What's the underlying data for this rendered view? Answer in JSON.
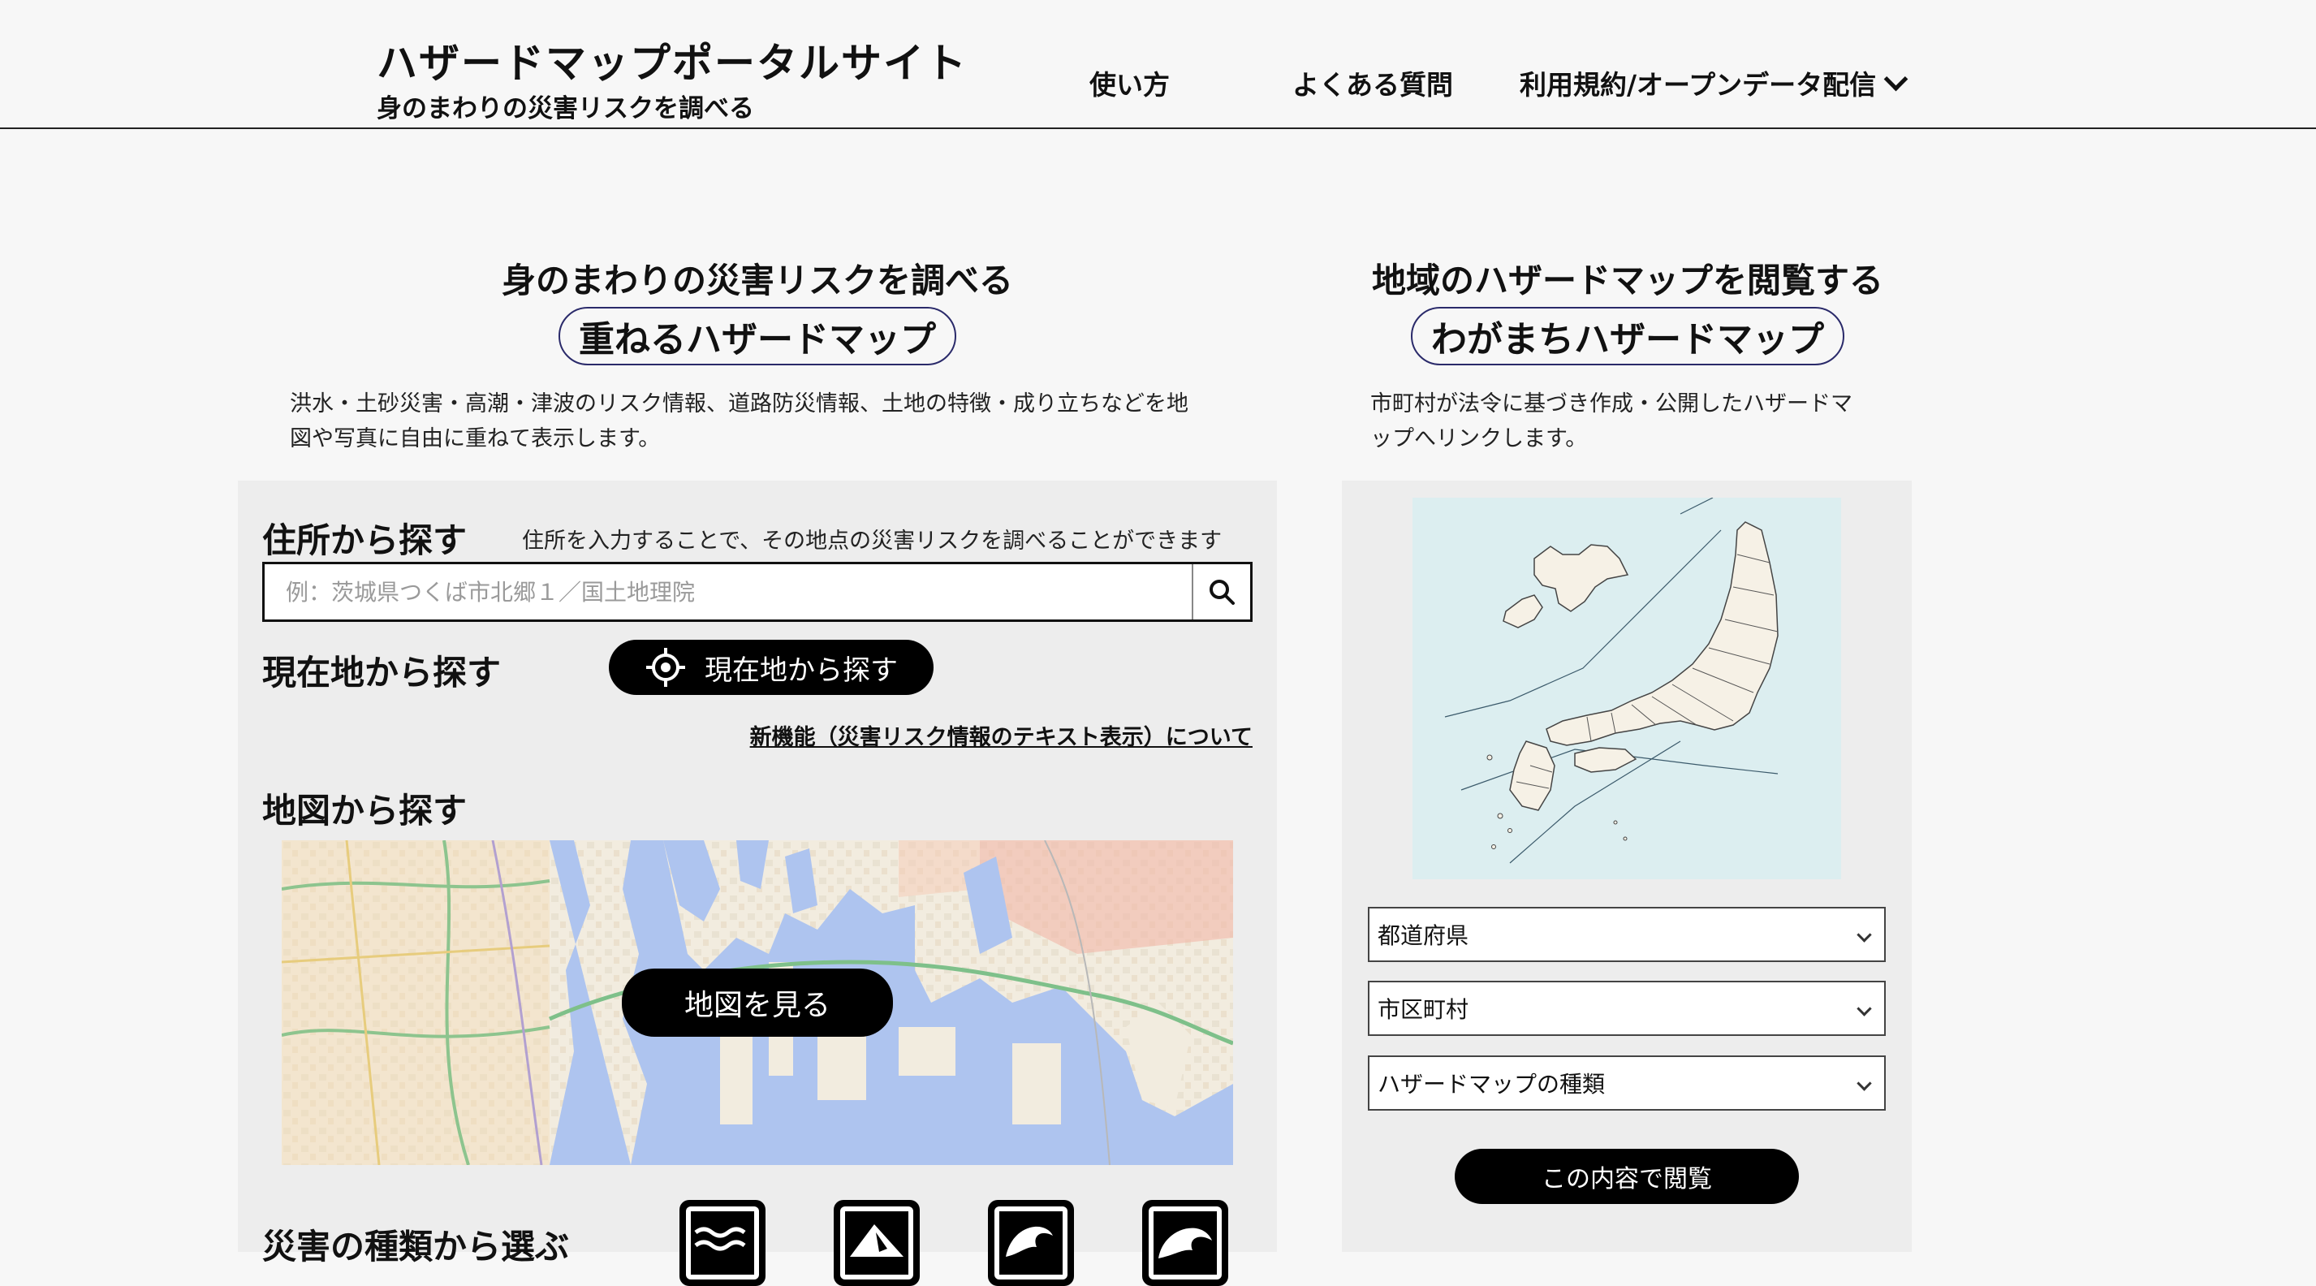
{
  "header": {
    "title": "ハザードマップポータルサイト",
    "subtitle": "身のまわりの災害リスクを調べる",
    "nav": [
      {
        "label": "使い方"
      },
      {
        "label": "よくある質問"
      },
      {
        "label": "利用規約/オープンデータ配信"
      }
    ]
  },
  "left_section": {
    "heading": "身のまわりの災害リスクを調べる",
    "pill": "重ねるハザードマップ",
    "description_line1": "洪水・土砂災害・高潮・津波のリスク情報、道路防災情報、土地の特徴・成り立ちなどを地",
    "description_line2": "図や写真に自由に重ねて表示します。",
    "address_search": {
      "heading": "住所から探す",
      "note": "住所を入力することで、その地点の災害リスクを調べることができます",
      "placeholder": "例：茨城県つくば市北郷１／国土地理院"
    },
    "current_location": {
      "heading": "現在地から探す",
      "button_label": "現在地から探す"
    },
    "new_feature_link": "新機能（災害リスク情報のテキスト表示）について",
    "map_search": {
      "heading": "地図から探す",
      "button_label": "地図を見る"
    },
    "disaster_type": {
      "heading": "災害の種類から選ぶ",
      "icons": [
        "flood-icon",
        "landslide-icon",
        "storm-surge-icon",
        "tsunami-icon"
      ]
    }
  },
  "right_section": {
    "heading": "地域のハザードマップを閲覧する",
    "pill": "わがまちハザードマップ",
    "description_line1": "市町村が法令に基づき作成・公開したハザードマ",
    "description_line2": "ップへリンクします。",
    "selects": [
      {
        "value": "都道府県"
      },
      {
        "value": "市区町村"
      },
      {
        "value": "ハザードマップの種類"
      }
    ],
    "view_button": "この内容で閲覧"
  },
  "colors": {
    "background": "#f7f7f7",
    "panel": "#ededed",
    "button": "#000000",
    "pill_border": "#2a2a6a",
    "map_sea": "#dceef0",
    "map_land": "#f3eee2"
  }
}
